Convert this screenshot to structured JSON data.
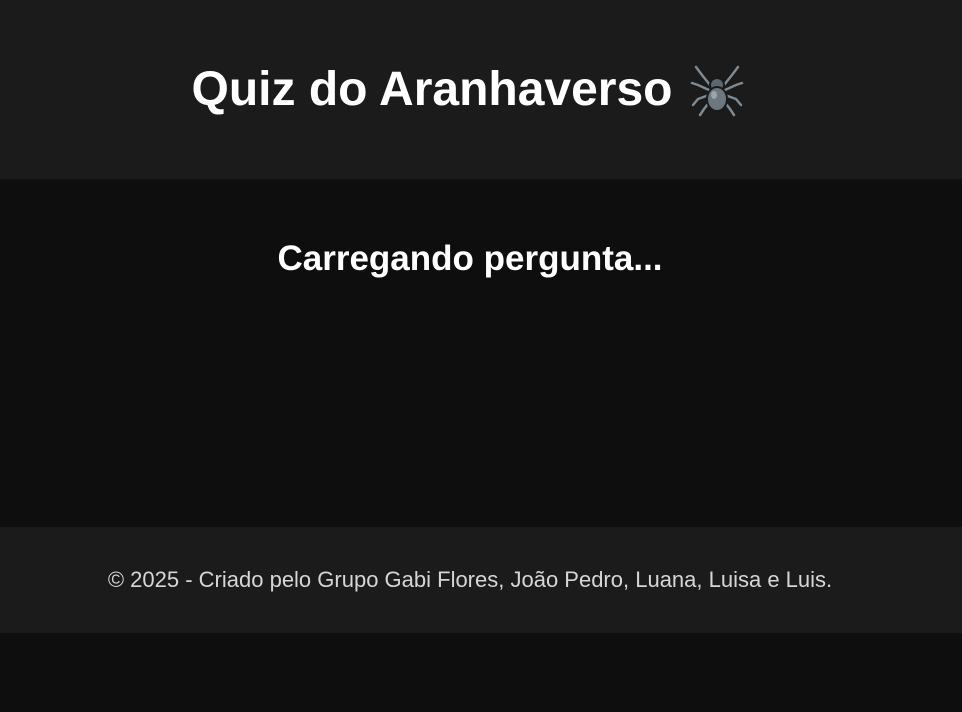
{
  "header": {
    "title": "Quiz do Aranhaverso",
    "icon": "spider-icon"
  },
  "main": {
    "loading_text": "Carregando pergunta..."
  },
  "footer": {
    "text": "© 2025 - Criado pelo Grupo Gabi Flores, João Pedro, Luana, Luisa e Luis."
  },
  "colors": {
    "header_bg": "#1b1b1b",
    "page_bg": "#0e0e0e",
    "footer_bg": "#1b1b1b",
    "title_text": "#ffffff",
    "footer_text": "#d6d6d6"
  }
}
